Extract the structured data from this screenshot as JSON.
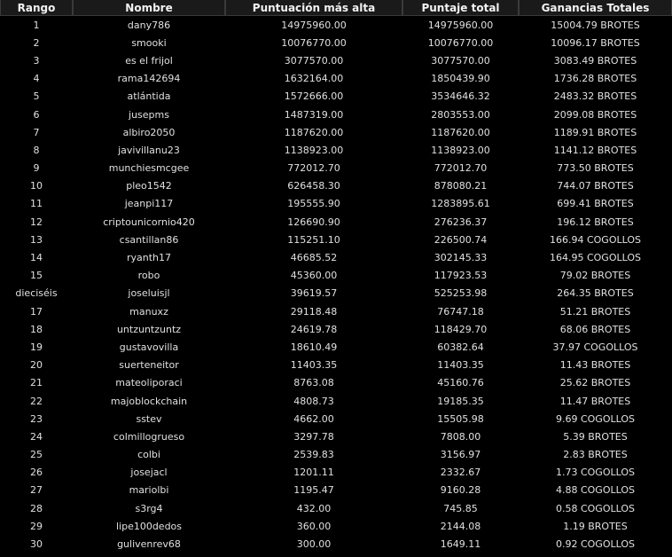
{
  "columns": {
    "rank": "Rango",
    "name": "Nombre",
    "high_score": "Puntuación más alta",
    "total_score": "Puntaje total",
    "earnings": "Ganancias Totales"
  },
  "rows": [
    {
      "rank": "1",
      "name": "dany786",
      "high": "14975960.00",
      "total": "14975960.00",
      "earnings": "15004.79 BROTES"
    },
    {
      "rank": "2",
      "name": "smooki",
      "high": "10076770.00",
      "total": "10076770.00",
      "earnings": "10096.17 BROTES"
    },
    {
      "rank": "3",
      "name": "es el frijol",
      "high": "3077570.00",
      "total": "3077570.00",
      "earnings": "3083.49 BROTES"
    },
    {
      "rank": "4",
      "name": "rama142694",
      "high": "1632164.00",
      "total": "1850439.90",
      "earnings": "1736.28 BROTES"
    },
    {
      "rank": "5",
      "name": "atlántida",
      "high": "1572666.00",
      "total": "3534646.32",
      "earnings": "2483.32 BROTES"
    },
    {
      "rank": "6",
      "name": "jusepms",
      "high": "1487319.00",
      "total": "2803553.00",
      "earnings": "2099.08 BROTES"
    },
    {
      "rank": "7",
      "name": "albiro2050",
      "high": "1187620.00",
      "total": "1187620.00",
      "earnings": "1189.91 BROTES"
    },
    {
      "rank": "8",
      "name": "javivillanu23",
      "high": "1138923.00",
      "total": "1138923.00",
      "earnings": "1141.12 BROTES"
    },
    {
      "rank": "9",
      "name": "munchiesmcgee",
      "high": "772012.70",
      "total": "772012.70",
      "earnings": "773.50 BROTES"
    },
    {
      "rank": "10",
      "name": "pleo1542",
      "high": "626458.30",
      "total": "878080.21",
      "earnings": "744.07 BROTES"
    },
    {
      "rank": "11",
      "name": "jeanpi117",
      "high": "195555.90",
      "total": "1283895.61",
      "earnings": "699.41 BROTES"
    },
    {
      "rank": "12",
      "name": "criptounicornio420",
      "high": "126690.90",
      "total": "276236.37",
      "earnings": "196.12 BROTES"
    },
    {
      "rank": "13",
      "name": "csantillan86",
      "high": "115251.10",
      "total": "226500.74",
      "earnings": "166.94 COGOLLOS"
    },
    {
      "rank": "14",
      "name": "ryanth17",
      "high": "46685.52",
      "total": "302145.33",
      "earnings": "164.95 COGOLLOS"
    },
    {
      "rank": "15",
      "name": "robo",
      "high": "45360.00",
      "total": "117923.53",
      "earnings": "79.02 BROTES"
    },
    {
      "rank": "dieciséis",
      "name": "joseluisjl",
      "high": "39619.57",
      "total": "525253.98",
      "earnings": "264.35 BROTES"
    },
    {
      "rank": "17",
      "name": "manuxz",
      "high": "29118.48",
      "total": "76747.18",
      "earnings": "51.21 BROTES"
    },
    {
      "rank": "18",
      "name": "untzuntzuntz",
      "high": "24619.78",
      "total": "118429.70",
      "earnings": "68.06 BROTES"
    },
    {
      "rank": "19",
      "name": "gustavovilla",
      "high": "18610.49",
      "total": "60382.64",
      "earnings": "37.97 COGOLLOS"
    },
    {
      "rank": "20",
      "name": "suerteneitor",
      "high": "11403.35",
      "total": "11403.35",
      "earnings": "11.43 BROTES"
    },
    {
      "rank": "21",
      "name": "mateoliporaci",
      "high": "8763.08",
      "total": "45160.76",
      "earnings": "25.62 BROTES"
    },
    {
      "rank": "22",
      "name": "majoblockchain",
      "high": "4808.73",
      "total": "19185.35",
      "earnings": "11.47 BROTES"
    },
    {
      "rank": "23",
      "name": "sstev",
      "high": "4662.00",
      "total": "15505.98",
      "earnings": "9.69 COGOLLOS"
    },
    {
      "rank": "24",
      "name": "colmillogrueso",
      "high": "3297.78",
      "total": "7808.00",
      "earnings": "5.39 BROTES"
    },
    {
      "rank": "25",
      "name": "colbi",
      "high": "2539.83",
      "total": "3156.97",
      "earnings": "2.83 BROTES"
    },
    {
      "rank": "26",
      "name": "josejacl",
      "high": "1201.11",
      "total": "2332.67",
      "earnings": "1.73 COGOLLOS"
    },
    {
      "rank": "27",
      "name": "mariolbi",
      "high": "1195.47",
      "total": "9160.28",
      "earnings": "4.88 COGOLLOS"
    },
    {
      "rank": "28",
      "name": "s3rg4",
      "high": "432.00",
      "total": "745.85",
      "earnings": "0.58 COGOLLOS"
    },
    {
      "rank": "29",
      "name": "lipe100dedos",
      "high": "360.00",
      "total": "2144.08",
      "earnings": "1.19 BROTES"
    },
    {
      "rank": "30",
      "name": "gulivenrev68",
      "high": "300.00",
      "total": "1649.11",
      "earnings": "0.92 COGOLLOS"
    }
  ]
}
